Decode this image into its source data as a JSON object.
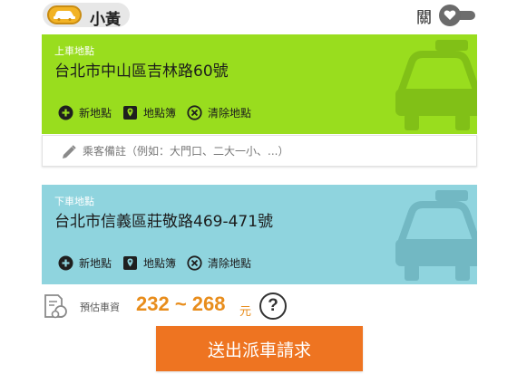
{
  "header": {
    "service_label": "小黃",
    "toggle_label": "關",
    "toggle_state": "off"
  },
  "pickup": {
    "label": "上車地點",
    "address": "台北市中山區吉林路60號",
    "actions": [
      {
        "label": "新地點",
        "icon": "add-circle-icon"
      },
      {
        "label": "地點簿",
        "icon": "map-pin-book-icon"
      },
      {
        "label": "清除地點",
        "icon": "clear-circle-icon"
      }
    ]
  },
  "note": {
    "placeholder": "乘客備註（例如：大門口、二大一小、...）",
    "value": ""
  },
  "dropoff": {
    "label": "下車地點",
    "address": "台北市信義區莊敬路469-471號",
    "actions": [
      {
        "label": "新地點",
        "icon": "add-circle-icon"
      },
      {
        "label": "地點簿",
        "icon": "map-pin-book-icon"
      },
      {
        "label": "清除地點",
        "icon": "clear-circle-icon"
      }
    ]
  },
  "fare": {
    "label": "預估車資",
    "range": "232 ~ 268",
    "unit": "元",
    "help": "?"
  },
  "submit": {
    "label": "送出派車請求"
  },
  "colors": {
    "pickup_bg": "#99dd1e",
    "dropoff_bg": "#8fd4de",
    "fare_accent": "#e88d1c",
    "submit_bg": "#ee7421",
    "taxi_yellow": "#f2b325"
  }
}
